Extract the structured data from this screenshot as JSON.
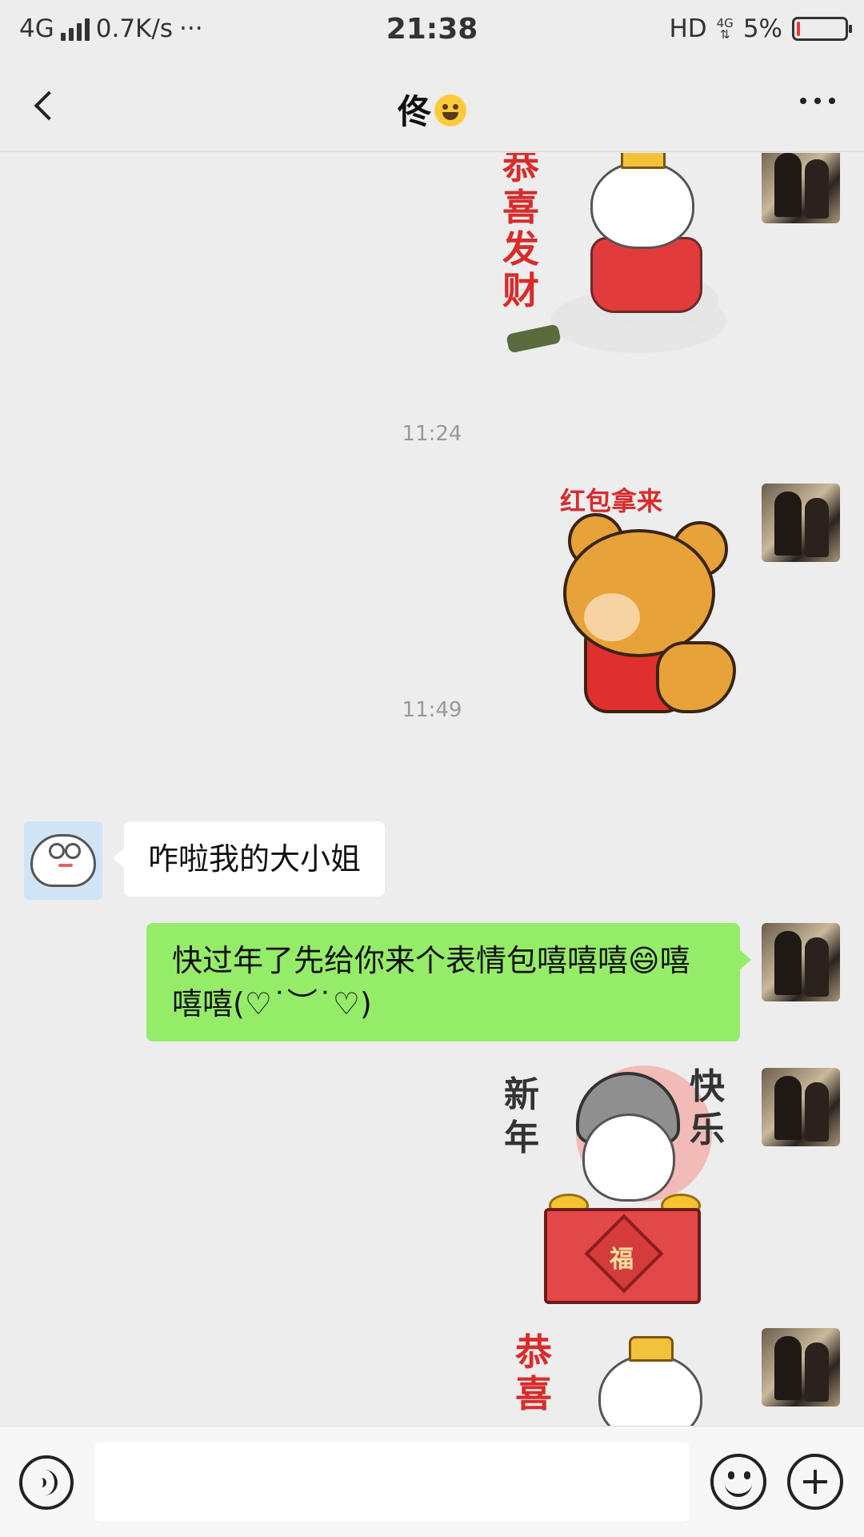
{
  "status_bar": {
    "network": "4G",
    "speed": "0.7K/s",
    "overflow": "···",
    "time": "21:38",
    "hd": "HD",
    "net_small": "4G",
    "battery_percent_text": "5%",
    "battery_level": 0.05,
    "battery_color": "#e53935"
  },
  "header": {
    "title": "佟",
    "title_emoji": "sweat-smile-emoji",
    "back_icon": "chevron-left-icon",
    "more_icon": "more-dots-icon"
  },
  "messages": {
    "sticker1_caption": "恭喜发财",
    "timestamp1": "11:24",
    "sticker2_caption": "红包拿来",
    "timestamp2": "11:49",
    "text_in": "咋啦我的大小姐",
    "text_out": "快过年了先给你来个表情包嘻嘻嘻😄嘻嘻嘻(♡˙︶˙♡)",
    "sticker3_caption_left": "新年",
    "sticker3_caption_right": "快乐",
    "sticker3_box_char": "福",
    "sticker4_caption": "恭喜"
  },
  "input_bar": {
    "voice_icon": "voice-icon",
    "input_value": "",
    "emoji_icon": "smiley-icon",
    "plus_icon": "plus-circle-icon"
  },
  "colors": {
    "background": "#ededed",
    "outgoing_bubble": "#95ec69",
    "incoming_bubble": "#ffffff",
    "timestamp": "#999999"
  }
}
